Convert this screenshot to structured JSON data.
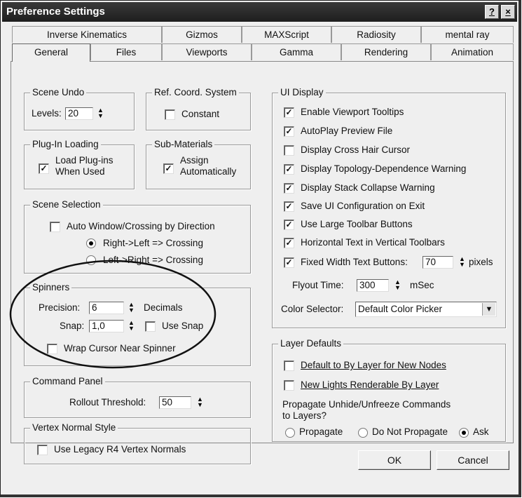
{
  "window": {
    "title": "Preference Settings",
    "help_label": "?",
    "close_label": "×"
  },
  "tabs_top": [
    "Inverse Kinematics",
    "Gizmos",
    "MAXScript",
    "Radiosity",
    "mental ray"
  ],
  "tabs_bottom": [
    "General",
    "Files",
    "Viewports",
    "Gamma",
    "Rendering",
    "Animation"
  ],
  "active_tab": "General",
  "scene_undo": {
    "title": "Scene Undo",
    "levels_label": "Levels:",
    "levels_value": "20"
  },
  "ref_coord": {
    "title": "Ref. Coord. System",
    "constant_label": "Constant",
    "constant_checked": false
  },
  "plugin_loading": {
    "title": "Plug-In Loading",
    "load_line1": "Load Plug-ins",
    "load_line2": "When Used",
    "load_checked": true
  },
  "sub_materials": {
    "title": "Sub-Materials",
    "assign_line1": "Assign",
    "assign_line2": "Automatically",
    "assign_checked": true
  },
  "scene_selection": {
    "title": "Scene Selection",
    "auto_window_label": "Auto Window/Crossing by Direction",
    "auto_window_checked": false,
    "rl_label": "Right->Left => Crossing",
    "lr_label": "Left->Right => Crossing",
    "selected": "Right->Left => Crossing"
  },
  "spinners": {
    "title": "Spinners",
    "precision_label": "Precision:",
    "precision_value": "6",
    "decimals_label": "Decimals",
    "snap_label": "Snap:",
    "snap_value": "1,0",
    "use_snap_label": "Use Snap",
    "use_snap_checked": false,
    "wrap_label": "Wrap Cursor Near Spinner",
    "wrap_checked": false
  },
  "command_panel": {
    "title": "Command Panel",
    "rollout_label": "Rollout Threshold:",
    "rollout_value": "50"
  },
  "vertex_normal": {
    "title": "Vertex Normal Style",
    "legacy_label": "Use Legacy R4 Vertex Normals",
    "legacy_checked": false
  },
  "ui_display": {
    "title": "UI Display",
    "options": [
      {
        "label": "Enable Viewport Tooltips",
        "checked": true
      },
      {
        "label": "AutoPlay Preview File",
        "checked": true
      },
      {
        "label": "Display Cross Hair Cursor",
        "checked": false
      },
      {
        "label": "Display Topology-Dependence Warning",
        "checked": true
      },
      {
        "label": "Display Stack Collapse Warning",
        "checked": true
      },
      {
        "label": "Save UI Configuration on Exit",
        "checked": true
      },
      {
        "label": "Use Large Toolbar Buttons",
        "checked": true
      },
      {
        "label": "Horizontal Text in Vertical Toolbars",
        "checked": true
      }
    ],
    "fixed_width_label": "Fixed Width Text Buttons:",
    "fixed_width_checked": true,
    "fixed_width_value": "70",
    "pixels_label": "pixels",
    "flyout_label": "Flyout Time:",
    "flyout_value": "300",
    "msec_label": "mSec",
    "color_selector_label": "Color Selector:",
    "color_selector_value": "Default Color Picker"
  },
  "layer_defaults": {
    "title": "Layer Defaults",
    "default_bylayer_label": "Default to By Layer for New Nodes",
    "default_bylayer_checked": false,
    "new_lights_label": "New Lights Renderable By Layer",
    "new_lights_checked": false,
    "propagate_line1": "Propagate Unhide/Unfreeze Commands",
    "propagate_line2": "to Layers?",
    "opt_propagate": "Propagate",
    "opt_do_not": "Do Not Propagate",
    "opt_ask": "Ask",
    "selected": "Ask"
  },
  "buttons": {
    "ok_label": "OK",
    "cancel_label": "Cancel"
  },
  "annotation": {
    "highlight": "ellipse around Spinners group",
    "color": "#111111"
  },
  "icons": {
    "checkmark": "check-icon",
    "spinner": "spinner-arrows-icon",
    "dropdown": "chevron-down-icon"
  }
}
